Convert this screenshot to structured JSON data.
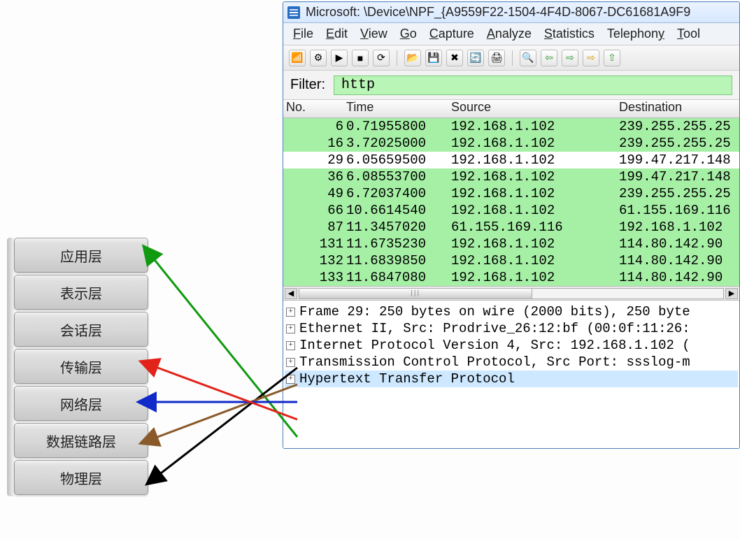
{
  "osi_layers": [
    "应用层",
    "表示层",
    "会话层",
    "传输层",
    "网络层",
    "数据链路层",
    "物理层"
  ],
  "window_title": "Microsoft: \\Device\\NPF_{A9559F22-1504-4F4D-8067-DC61681A9F9",
  "menu": {
    "file": "File",
    "edit": "Edit",
    "view": "View",
    "go": "Go",
    "capture": "Capture",
    "analyze": "Analyze",
    "statistics": "Statistics",
    "telephony": "Telephony",
    "tools": "Tools"
  },
  "filter_label": "Filter:",
  "filter_value": "http",
  "columns": {
    "no": "No.",
    "time": "Time",
    "source": "Source",
    "destination": "Destination"
  },
  "packets": [
    {
      "no": "6",
      "time": "0.71955800",
      "src": "192.168.1.102",
      "dst": "239.255.255.25",
      "cls": "green"
    },
    {
      "no": "16",
      "time": "3.72025000",
      "src": "192.168.1.102",
      "dst": "239.255.255.25",
      "cls": "green"
    },
    {
      "no": "29",
      "time": "6.05659500",
      "src": "192.168.1.102",
      "dst": "199.47.217.148",
      "cls": "white"
    },
    {
      "no": "36",
      "time": "6.08553700",
      "src": "192.168.1.102",
      "dst": "199.47.217.148",
      "cls": "green"
    },
    {
      "no": "49",
      "time": "6.72037400",
      "src": "192.168.1.102",
      "dst": "239.255.255.25",
      "cls": "green"
    },
    {
      "no": "66",
      "time": "10.6614540",
      "src": "192.168.1.102",
      "dst": "61.155.169.116",
      "cls": "green"
    },
    {
      "no": "87",
      "time": "11.3457020",
      "src": "61.155.169.116",
      "dst": "192.168.1.102",
      "cls": "green"
    },
    {
      "no": "131",
      "time": "11.6735230",
      "src": "192.168.1.102",
      "dst": "114.80.142.90",
      "cls": "green"
    },
    {
      "no": "132",
      "time": "11.6839850",
      "src": "192.168.1.102",
      "dst": "114.80.142.90",
      "cls": "green"
    },
    {
      "no": "133",
      "time": "11.6847080",
      "src": "192.168.1.102",
      "dst": "114.80.142.90",
      "cls": "green"
    }
  ],
  "tree": [
    "Frame 29: 250 bytes on wire (2000 bits), 250 byte",
    "Ethernet II, Src: Prodrive_26:12:bf (00:0f:11:26:",
    "Internet Protocol Version 4, Src: 192.168.1.102 (",
    "Transmission Control Protocol, Src Port: ssslog-m",
    "Hypertext Transfer Protocol"
  ],
  "scroll_grip": "|||",
  "toolbar_icons": [
    "interfaces-icon",
    "options-icon",
    "start-icon",
    "stop-icon",
    "restart-icon",
    "sep",
    "open-icon",
    "save-icon",
    "close-icon",
    "reload-icon",
    "print-icon",
    "sep",
    "find-icon",
    "back-icon",
    "forward-icon",
    "jump-icon",
    "top-icon"
  ],
  "colors": {
    "row_green": "#a6f0a6",
    "filter_bg": "#b9f5b7",
    "tree_selected": "#cde8ff",
    "arrow_green": "#0f9a10",
    "arrow_red": "#e2231a",
    "arrow_blue": "#1029c9",
    "arrow_brown": "#8a5a2a",
    "arrow_black": "#000000"
  }
}
